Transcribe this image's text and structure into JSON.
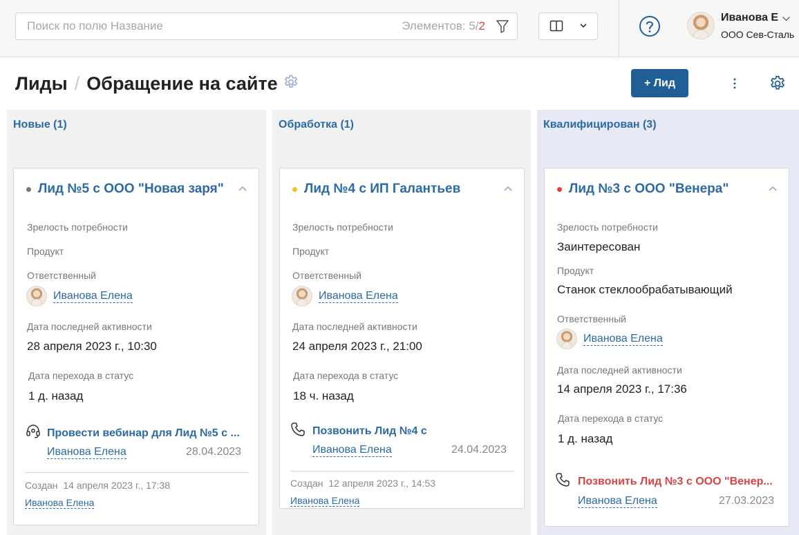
{
  "search": {
    "placeholder": "Поиск по полю Название",
    "count_label": "Элементов: 5",
    "count_sep": "/",
    "count_alt": "2"
  },
  "user": {
    "name": "Иванова Е",
    "company": "ООО Сев-Сталь"
  },
  "breadcrumb": {
    "section": "Лиды",
    "separator": "/",
    "page": "Обращение на сайте"
  },
  "toolbar": {
    "add_label": "+ Лид"
  },
  "colors": {
    "accent": "#1f5f95",
    "link": "#2b6aa6",
    "overdue": "#d64541",
    "dot_new": "#777777",
    "dot_processing": "#f0c419",
    "dot_qualified": "#d64541"
  },
  "labels": {
    "maturity": "Зрелость потребности",
    "product": "Продукт",
    "responsible": "Ответственный",
    "last_activity": "Дата последней активности",
    "status_change": "Дата перехода в статус",
    "created": "Создан"
  },
  "columns": [
    {
      "title": "Новые (1)",
      "card": {
        "title": "Лид №5 с ООО \"Новая заря\"",
        "responsible": "Иванова Елена",
        "last_activity": "28 апреля 2023 г., 10:30",
        "status_change": "1 д. назад",
        "task": {
          "icon": "webinar-headset-icon",
          "title": "Провести вебинар для Лид №5 с ...",
          "responsible": "Иванова Елена",
          "date": "28.04.2023"
        },
        "created_at": "14 апреля 2023 г., 17:38",
        "created_by": "Иванова Елена"
      }
    },
    {
      "title": "Обработка (1)",
      "card": {
        "title": "Лид №4 с ИП Галантьев",
        "responsible": "Иванова Елена",
        "last_activity": "24 апреля 2023 г., 21:00",
        "status_change": "18 ч. назад",
        "task": {
          "icon": "phone-icon",
          "title": "Позвонить Лид №4 с",
          "responsible": "Иванова Елена",
          "date": "24.04.2023"
        },
        "created_at": "12 апреля 2023 г., 14:53",
        "created_by": "Иванова Елена"
      }
    },
    {
      "title": "Квалифицирован (3)",
      "card": {
        "title": "Лид №3 с ООО \"Венера\"",
        "maturity": "Заинтересован",
        "product": "Станок стеклообрабатывающий",
        "responsible": "Иванова Елена",
        "last_activity": "14 апреля 2023 г., 17:36",
        "status_change": "1 д. назад",
        "task": {
          "icon": "phone-icon",
          "title": "Позвонить Лид №3 с ООО \"Венер...",
          "responsible": "Иванова Елена",
          "date": "27.03.2023"
        }
      }
    }
  ]
}
